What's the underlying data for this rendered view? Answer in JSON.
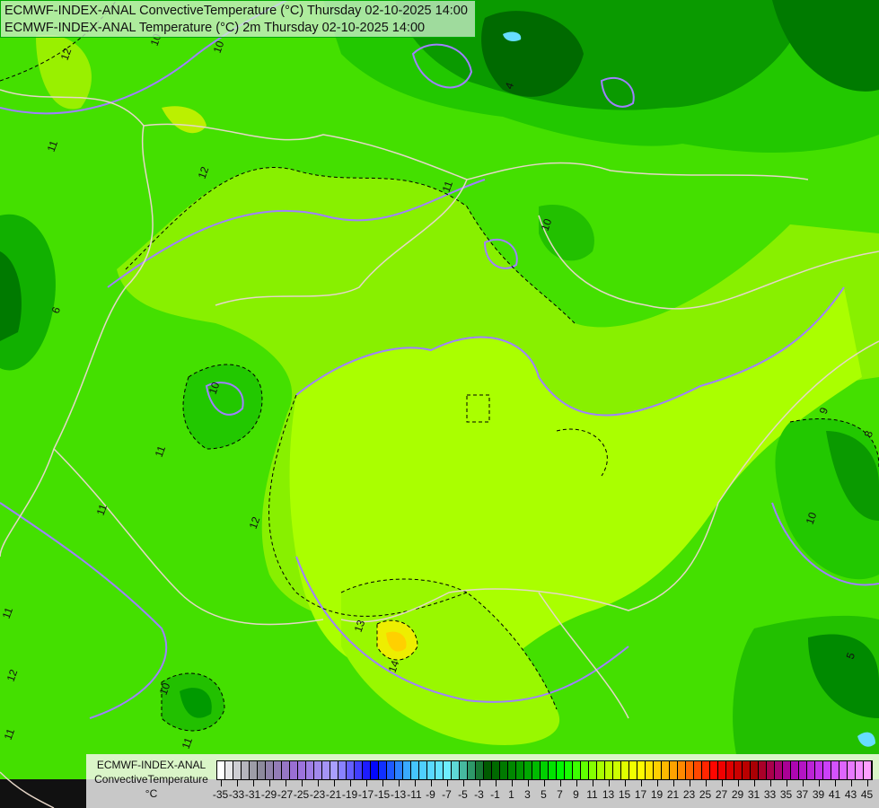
{
  "header": {
    "line1": "ECMWF-INDEX-ANAL ConvectiveTemperature (°C) Thursday 02-10-2025 14:00",
    "line2": "ECMWF-INDEX-ANAL Temperature (°C) 2m Thursday 02-10-2025 14:00"
  },
  "legend": {
    "model": "ECMWF-INDEX-ANAL",
    "parameter": "ConvectiveTemperature",
    "unit": "°C",
    "min": -35,
    "max": 45,
    "labels": [
      "-35",
      "-33",
      "-31",
      "-29",
      "-27",
      "-25",
      "-23",
      "-21",
      "-19",
      "-17",
      "-15",
      "-13",
      "-11",
      "-9",
      "-7",
      "-5",
      "-3",
      "-1",
      "1",
      "3",
      "5",
      "7",
      "9",
      "11",
      "13",
      "15",
      "17",
      "19",
      "21",
      "23",
      "25",
      "27",
      "29",
      "31",
      "33",
      "35",
      "37",
      "39",
      "41",
      "43",
      "45"
    ],
    "color_stops": [
      "#ffffff",
      "#8c8c98",
      "#9a6cd8",
      "#a8a0ff",
      "#0000ff",
      "#40c0ff",
      "#70f0ff",
      "#005a00",
      "#00a000",
      "#00ff00",
      "#aaff00",
      "#ffff00",
      "#ff9900",
      "#ff0000",
      "#aa0000",
      "#aa00aa",
      "#cc44ff",
      "#ffa0ff"
    ]
  },
  "contour_labels": [
    "12",
    "10",
    "11",
    "12",
    "6",
    "10",
    "11",
    "11",
    "12",
    "10",
    "11",
    "13",
    "14",
    "10",
    "11",
    "12",
    "11",
    "8",
    "9",
    "10",
    "5",
    "4",
    "11",
    "10"
  ],
  "colors": {
    "border_line": "#e0d0c0",
    "temp_contour": "#a080ff",
    "conv_contour": "#000000"
  }
}
